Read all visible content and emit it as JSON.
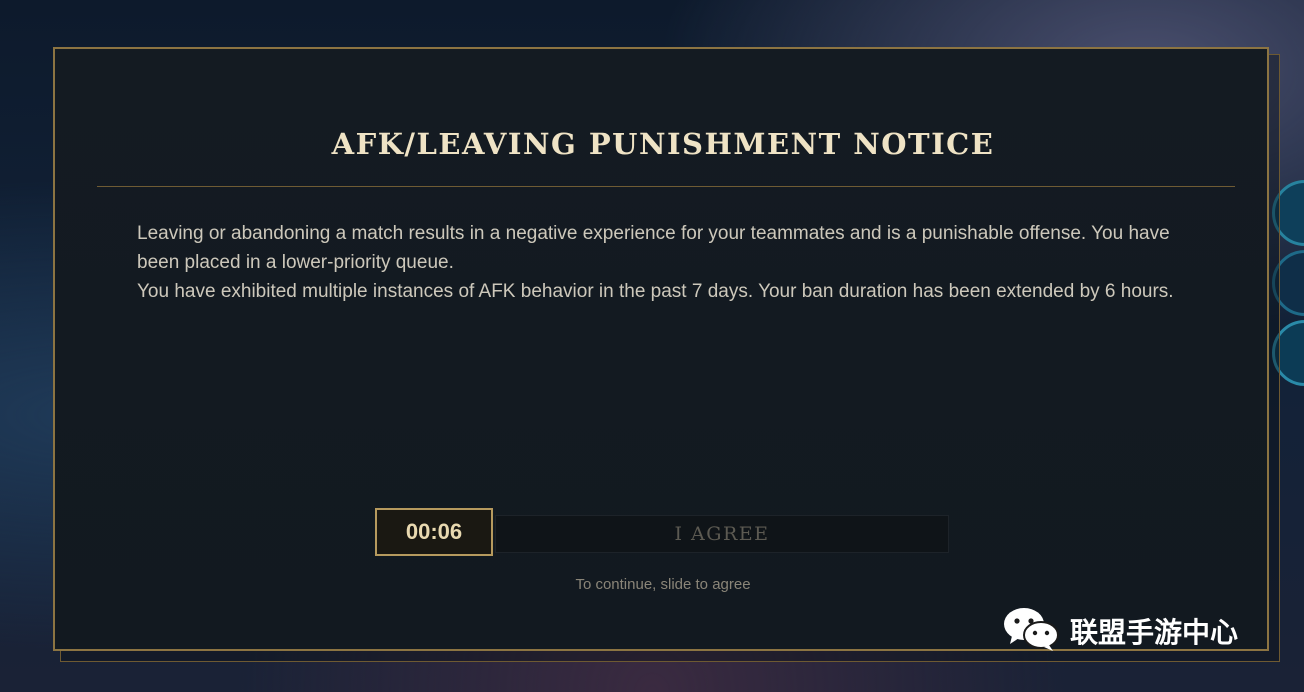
{
  "dialog": {
    "title": "AFK/LEAVING PUNISHMENT NOTICE",
    "paragraph_1": "Leaving or abandoning a match results in a negative experience for your teammates and is a punishable offense. You have been placed in a lower-priority queue.",
    "paragraph_2": "You have exhibited multiple instances of AFK behavior in the past 7 days. Your ban duration has been extended by 6 hours.",
    "timer": "00:06",
    "agree_label": "I AGREE",
    "hint": "To continue, slide to agree"
  },
  "watermark": {
    "icon": "wechat-icon",
    "text": "联盟手游中心"
  },
  "colors": {
    "gold_border": "#8c7442",
    "title_text": "#efe3c5",
    "panel_bg": "#141b22"
  }
}
